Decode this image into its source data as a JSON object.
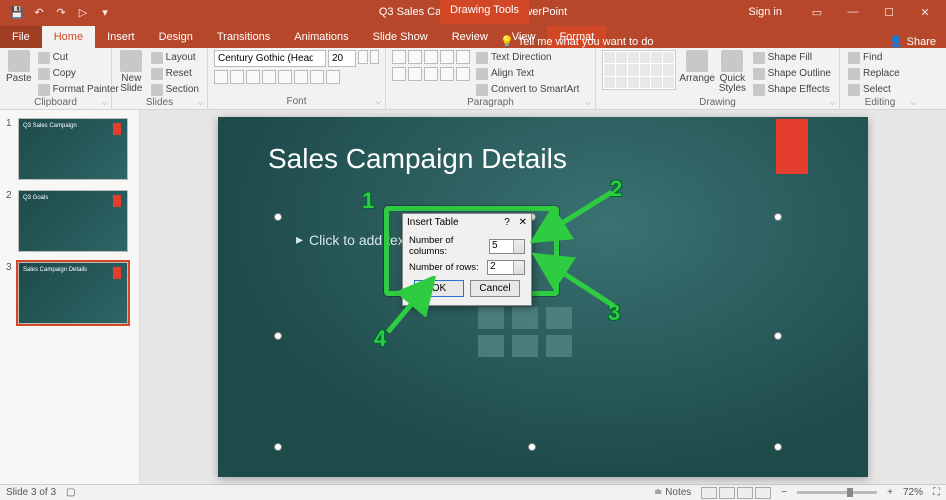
{
  "app": {
    "filename": "Q3 Sales Campaign.pptx  -  PowerPoint",
    "context_tab_group": "Drawing Tools",
    "signin": "Sign in"
  },
  "qat": [
    "save",
    "undo",
    "redo",
    "start",
    "touch"
  ],
  "tabs": {
    "file": "File",
    "items": [
      "Home",
      "Insert",
      "Design",
      "Transitions",
      "Animations",
      "Slide Show",
      "Review",
      "View"
    ],
    "context": "Format",
    "active": "Home",
    "tell_me": "Tell me what you want to do",
    "share": "Share"
  },
  "ribbon": {
    "clipboard": {
      "label": "Clipboard",
      "paste": "Paste",
      "cut": "Cut",
      "copy": "Copy",
      "format_painter": "Format Painter"
    },
    "slides": {
      "label": "Slides",
      "new_slide": "New\nSlide",
      "layout": "Layout",
      "reset": "Reset",
      "section": "Section"
    },
    "font": {
      "label": "Font",
      "name": "Century Gothic (Head",
      "size": "20"
    },
    "paragraph": {
      "label": "Paragraph",
      "text_direction": "Text Direction",
      "align_text": "Align Text",
      "smartart": "Convert to SmartArt"
    },
    "drawing": {
      "label": "Drawing",
      "arrange": "Arrange",
      "quick_styles": "Quick\nStyles",
      "shape_fill": "Shape Fill",
      "shape_outline": "Shape Outline",
      "shape_effects": "Shape Effects"
    },
    "editing": {
      "label": "Editing",
      "find": "Find",
      "replace": "Replace",
      "select": "Select"
    }
  },
  "thumbnails": [
    {
      "num": "1",
      "title": "Q3 Sales Campaign"
    },
    {
      "num": "2",
      "title": "Q3 Goals"
    },
    {
      "num": "3",
      "title": "Sales Campaign Details"
    }
  ],
  "active_thumb": 3,
  "slide": {
    "title": "Sales Campaign Details",
    "placeholder_text": "Click to add text"
  },
  "dialog": {
    "title": "Insert Table",
    "help": "?",
    "close": "✕",
    "cols_label": "Number of columns:",
    "cols_value": "5",
    "rows_label": "Number of rows:",
    "rows_value": "2",
    "ok": "OK",
    "cancel": "Cancel"
  },
  "annotations": {
    "n1": "1",
    "n2": "2",
    "n3": "3",
    "n4": "4"
  },
  "status": {
    "left": "Slide 3 of 3",
    "notes": "Notes",
    "zoom": "72%"
  }
}
